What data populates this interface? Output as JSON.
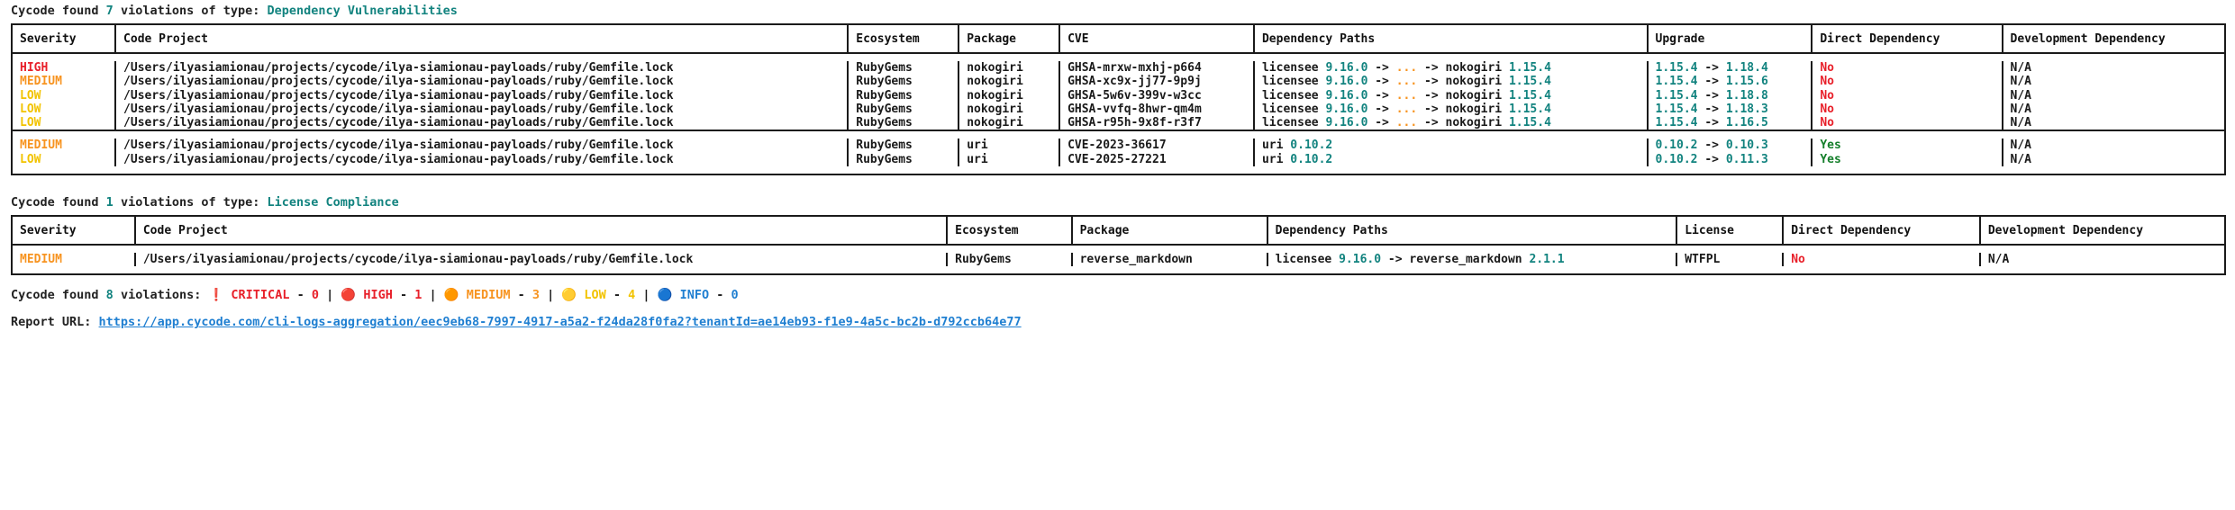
{
  "sections": [
    {
      "heading": {
        "prefix": "Cycode found ",
        "count": "7",
        "middle": " violations of type: ",
        "type": "Dependency Vulnerabilities"
      },
      "columns": [
        "Severity",
        "Code Project",
        "Ecosystem",
        "Package",
        "CVE",
        "Dependency Paths",
        "Upgrade",
        "Direct Dependency",
        "Development Dependency"
      ],
      "groups": [
        {
          "rows": [
            {
              "severity": "HIGH",
              "severity_color": "#e8202a",
              "code_project": "/Users/ilyasiamionau/projects/cycode/ilya-siamionau-payloads/ruby/Gemfile.lock",
              "ecosystem": "RubyGems",
              "package": "nokogiri",
              "cve": "GHSA-mrxw-mxhj-p664",
              "dep_path_root": "licensee",
              "dep_path_root_version": "9.16.0",
              "dep_path_mid": " -> ",
              "dep_path_ellipsis": "...",
              "dep_path_tail": " -> nokogiri ",
              "dep_path_tail_version": "1.15.4",
              "upgrade_from": "1.15.4",
              "upgrade_arrow": " -> ",
              "upgrade_to": "1.18.4",
              "direct": "No",
              "direct_color": "#e8202a",
              "dev": "N/A"
            },
            {
              "severity": "MEDIUM",
              "severity_color": "#f79421",
              "code_project": "/Users/ilyasiamionau/projects/cycode/ilya-siamionau-payloads/ruby/Gemfile.lock",
              "ecosystem": "RubyGems",
              "package": "nokogiri",
              "cve": "GHSA-xc9x-jj77-9p9j",
              "dep_path_root": "licensee",
              "dep_path_root_version": "9.16.0",
              "dep_path_mid": " -> ",
              "dep_path_ellipsis": "...",
              "dep_path_tail": " -> nokogiri ",
              "dep_path_tail_version": "1.15.4",
              "upgrade_from": "1.15.4",
              "upgrade_arrow": " -> ",
              "upgrade_to": "1.15.6",
              "direct": "No",
              "direct_color": "#e8202a",
              "dev": "N/A"
            },
            {
              "severity": "LOW",
              "severity_color": "#f2c300",
              "code_project": "/Users/ilyasiamionau/projects/cycode/ilya-siamionau-payloads/ruby/Gemfile.lock",
              "ecosystem": "RubyGems",
              "package": "nokogiri",
              "cve": "GHSA-5w6v-399v-w3cc",
              "dep_path_root": "licensee",
              "dep_path_root_version": "9.16.0",
              "dep_path_mid": " -> ",
              "dep_path_ellipsis": "...",
              "dep_path_tail": " -> nokogiri ",
              "dep_path_tail_version": "1.15.4",
              "upgrade_from": "1.15.4",
              "upgrade_arrow": " -> ",
              "upgrade_to": "1.18.8",
              "direct": "No",
              "direct_color": "#e8202a",
              "dev": "N/A"
            },
            {
              "severity": "LOW",
              "severity_color": "#f2c300",
              "code_project": "/Users/ilyasiamionau/projects/cycode/ilya-siamionau-payloads/ruby/Gemfile.lock",
              "ecosystem": "RubyGems",
              "package": "nokogiri",
              "cve": "GHSA-vvfq-8hwr-qm4m",
              "dep_path_root": "licensee",
              "dep_path_root_version": "9.16.0",
              "dep_path_mid": " -> ",
              "dep_path_ellipsis": "...",
              "dep_path_tail": " -> nokogiri ",
              "dep_path_tail_version": "1.15.4",
              "upgrade_from": "1.15.4",
              "upgrade_arrow": " -> ",
              "upgrade_to": "1.18.3",
              "direct": "No",
              "direct_color": "#e8202a",
              "dev": "N/A"
            },
            {
              "severity": "LOW",
              "severity_color": "#f2c300",
              "code_project": "/Users/ilyasiamionau/projects/cycode/ilya-siamionau-payloads/ruby/Gemfile.lock",
              "ecosystem": "RubyGems",
              "package": "nokogiri",
              "cve": "GHSA-r95h-9x8f-r3f7",
              "dep_path_root": "licensee",
              "dep_path_root_version": "9.16.0",
              "dep_path_mid": " -> ",
              "dep_path_ellipsis": "...",
              "dep_path_tail": " -> nokogiri ",
              "dep_path_tail_version": "1.15.4",
              "upgrade_from": "1.15.4",
              "upgrade_arrow": " -> ",
              "upgrade_to": "1.16.5",
              "direct": "No",
              "direct_color": "#e8202a",
              "dev": "N/A"
            }
          ]
        },
        {
          "rows": [
            {
              "severity": "MEDIUM",
              "severity_color": "#f79421",
              "code_project": "/Users/ilyasiamionau/projects/cycode/ilya-siamionau-payloads/ruby/Gemfile.lock",
              "ecosystem": "RubyGems",
              "package": "uri",
              "cve": "CVE-2023-36617",
              "dep_path_root": "uri",
              "dep_path_root_version": "0.10.2",
              "dep_path_mid": "",
              "dep_path_ellipsis": "",
              "dep_path_tail": "",
              "dep_path_tail_version": "",
              "upgrade_from": "0.10.2",
              "upgrade_arrow": " -> ",
              "upgrade_to": "0.10.3",
              "direct": "Yes",
              "direct_color": "#157f2b",
              "dev": "N/A"
            },
            {
              "severity": "LOW",
              "severity_color": "#f2c300",
              "code_project": "/Users/ilyasiamionau/projects/cycode/ilya-siamionau-payloads/ruby/Gemfile.lock",
              "ecosystem": "RubyGems",
              "package": "uri",
              "cve": "CVE-2025-27221",
              "dep_path_root": "uri",
              "dep_path_root_version": "0.10.2",
              "dep_path_mid": "",
              "dep_path_ellipsis": "",
              "dep_path_tail": "",
              "dep_path_tail_version": "",
              "upgrade_from": "0.10.2",
              "upgrade_arrow": " -> ",
              "upgrade_to": "0.11.3",
              "direct": "Yes",
              "direct_color": "#157f2b",
              "dev": "N/A"
            }
          ]
        }
      ]
    }
  ],
  "license_section": {
    "heading": {
      "prefix": "Cycode found ",
      "count": "1",
      "middle": " violations of type: ",
      "type": "License Compliance"
    },
    "columns": [
      "Severity",
      "Code Project",
      "Ecosystem",
      "Package",
      "Dependency Paths",
      "License",
      "Direct Dependency",
      "Development Dependency"
    ],
    "rows": [
      {
        "severity": "MEDIUM",
        "severity_color": "#f79421",
        "code_project": "/Users/ilyasiamionau/projects/cycode/ilya-siamionau-payloads/ruby/Gemfile.lock",
        "ecosystem": "RubyGems",
        "package": "reverse_markdown",
        "dep_path_root": "licensee",
        "dep_path_root_version": "9.16.0",
        "dep_path_mid": " -> reverse_markdown ",
        "dep_path_tail_version": "2.1.1",
        "license": "WTFPL",
        "direct": "No",
        "direct_color": "#e8202a",
        "dev": "N/A"
      }
    ]
  },
  "summary": {
    "prefix": "Cycode found ",
    "total": "8",
    "label": " violations: ",
    "items": [
      {
        "icon": "❗",
        "name": "CRITICAL",
        "color": "#e8202a",
        "dash": " - ",
        "count": "0"
      },
      {
        "icon": "🔴",
        "name": "HIGH",
        "color": "#e8202a",
        "dash": " - ",
        "count": "1"
      },
      {
        "icon": "🟠",
        "name": "MEDIUM",
        "color": "#f79421",
        "dash": " - ",
        "count": "3"
      },
      {
        "icon": "🟡",
        "name": "LOW",
        "color": "#f2c300",
        "dash": " - ",
        "count": "4"
      },
      {
        "icon": "🔵",
        "name": "INFO",
        "color": "#1f7fd1",
        "dash": " - ",
        "count": "0"
      }
    ],
    "separator": " | "
  },
  "report": {
    "label": "Report URL: ",
    "url": "https://app.cycode.com/cli-logs-aggregation/eec9eb68-7997-4917-a5a2-f24da28f0fa2?tenantId=ae14eb93-f1e9-4a5c-bc2b-d792ccb64e77"
  }
}
